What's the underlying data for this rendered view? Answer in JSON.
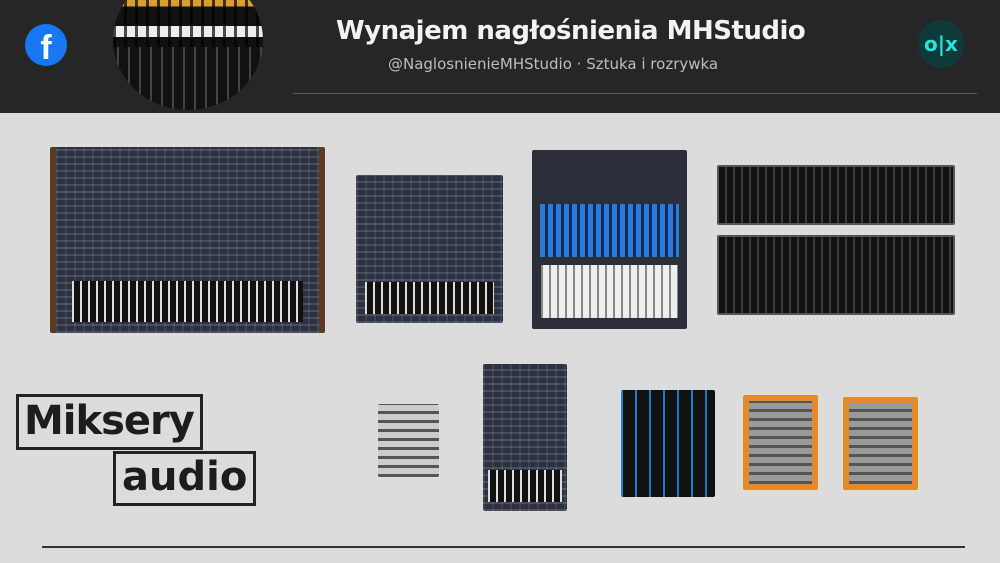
{
  "header": {
    "title": "Wynajem nagłośnienia MHStudio",
    "subtitle": "@NaglosnienieMHStudio · Sztuka i rozrywka",
    "facebook_icon": "f",
    "olx_icon": "o|x"
  },
  "logo": {
    "line1": "Miksery",
    "line2": "audio"
  }
}
